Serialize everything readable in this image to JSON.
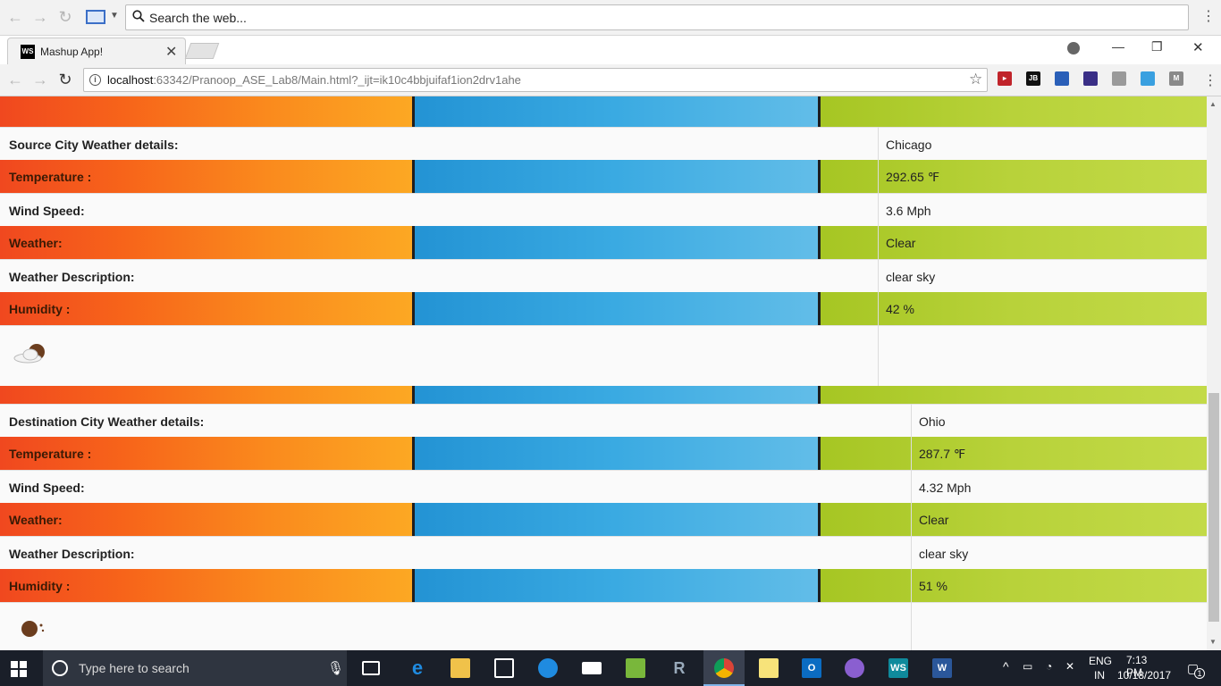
{
  "outer_toolbar": {
    "search_placeholder": "Search the web...",
    "kebab": "⋮"
  },
  "tab": {
    "favicon_label": "WS",
    "title": "Mashup App!",
    "close": "✕"
  },
  "window_controls": {
    "minimize": "—",
    "maximize": "❐",
    "close": "✕"
  },
  "address_bar": {
    "host": "localhost",
    "path": ":63342/Pranoop_ASE_Lab8/Main.html?_ijt=ik10c4bbjuifaf1ion2drv1ahe",
    "star": "☆"
  },
  "extensions": [
    {
      "name": "red-ext-icon",
      "label": "▸",
      "color": "#c0242b"
    },
    {
      "name": "jetbrains-ext-icon",
      "label": "JB",
      "color": "#111111"
    },
    {
      "name": "bookmark-ext-icon",
      "label": "",
      "color": "#2a5fb8"
    },
    {
      "name": "mask-ext-icon",
      "label": "",
      "color": "#3a2f86"
    },
    {
      "name": "circle-ext-icon",
      "label": "",
      "color": "#9a9a9a"
    },
    {
      "name": "weather-ext-icon",
      "label": "",
      "color": "#3aa0e0"
    },
    {
      "name": "m-ext-icon",
      "label": "M",
      "color": "#8a8a8a"
    }
  ],
  "source": {
    "heading": "Source City Weather details:",
    "heading_value": "Chicago",
    "rows": [
      {
        "label": "Temperature :",
        "value": "292.65 ℉"
      },
      {
        "label": "Wind Speed:",
        "value": "3.6 Mph"
      },
      {
        "label": "Weather:",
        "value": "Clear"
      },
      {
        "label": "Weather Description:",
        "value": "clear sky"
      },
      {
        "label": "Humidity :",
        "value": "42 %"
      }
    ],
    "icon": "partly-cloudy-night-icon"
  },
  "destination": {
    "heading": "Destination City Weather details:",
    "heading_value": "Ohio",
    "rows": [
      {
        "label": "Temperature :",
        "value": "287.7 ℉"
      },
      {
        "label": "Wind Speed:",
        "value": "4.32 Mph"
      },
      {
        "label": "Weather:",
        "value": "Clear"
      },
      {
        "label": "Weather Description:",
        "value": "clear sky"
      },
      {
        "label": "Humidity :",
        "value": "51 %"
      }
    ],
    "icon": "clear-night-icon"
  },
  "taskbar": {
    "search_placeholder": "Type here to search",
    "language_top": "ENG",
    "language_bottom": "IN",
    "time": "7:13 PM",
    "date": "10/18/2017",
    "notification_count": "1"
  }
}
